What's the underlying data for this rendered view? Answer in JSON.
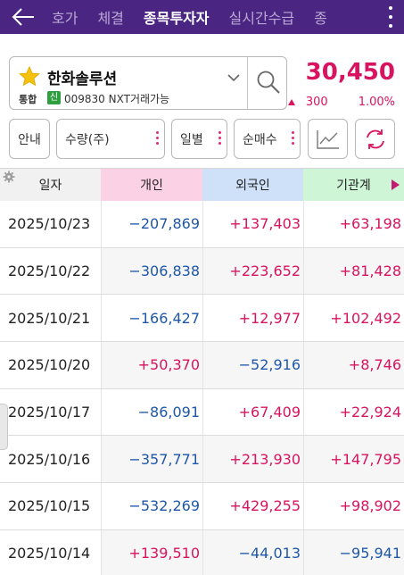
{
  "header": {
    "tabs": [
      {
        "label": "호가",
        "active": false
      },
      {
        "label": "체결",
        "active": false
      },
      {
        "label": "종목투자자",
        "active": true
      },
      {
        "label": "실시간수급",
        "active": false
      },
      {
        "label": "종",
        "active": false
      }
    ]
  },
  "stock": {
    "name": "한화솔루션",
    "market_badge": "통합",
    "nxt_badge": "신",
    "code_info": "009830 NXT거래가능",
    "price": "30,450",
    "change": "300",
    "change_pct": "1.00%"
  },
  "filters": {
    "info": "안내",
    "unit": "수량(주)",
    "period": "일별",
    "type": "순매수"
  },
  "table": {
    "headers": [
      "일자",
      "개인",
      "외국인",
      "기관계"
    ],
    "rows": [
      {
        "date": "2025/10/23",
        "individual": "−207,869",
        "foreign": "+137,403",
        "institution": "+63,198"
      },
      {
        "date": "2025/10/22",
        "individual": "−306,838",
        "foreign": "+223,652",
        "institution": "+81,428"
      },
      {
        "date": "2025/10/21",
        "individual": "−166,427",
        "foreign": "+12,977",
        "institution": "+102,492"
      },
      {
        "date": "2025/10/20",
        "individual": "+50,370",
        "foreign": "−52,916",
        "institution": "+8,746"
      },
      {
        "date": "2025/10/17",
        "individual": "−86,091",
        "foreign": "+67,409",
        "institution": "+22,924"
      },
      {
        "date": "2025/10/16",
        "individual": "−357,771",
        "foreign": "+213,930",
        "institution": "+147,795"
      },
      {
        "date": "2025/10/15",
        "individual": "−532,269",
        "foreign": "+429,255",
        "institution": "+98,902"
      },
      {
        "date": "2025/10/14",
        "individual": "+139,510",
        "foreign": "−44,013",
        "institution": "−95,941"
      }
    ]
  },
  "colors": {
    "header_bg": "#4b2582",
    "positive": "#d8135f",
    "negative": "#1f57a8",
    "individual_header": "#fbd1e6",
    "foreign_header": "#cfe0f9",
    "institution_header": "#cdf5d6"
  },
  "icons": {
    "back": "back-arrow-icon",
    "more": "kebab-menu-icon",
    "favorite": "star-icon",
    "dropdown": "chevron-down-icon",
    "search": "search-icon",
    "chart": "line-chart-icon",
    "refresh": "refresh-icon",
    "settings": "gear-icon"
  }
}
